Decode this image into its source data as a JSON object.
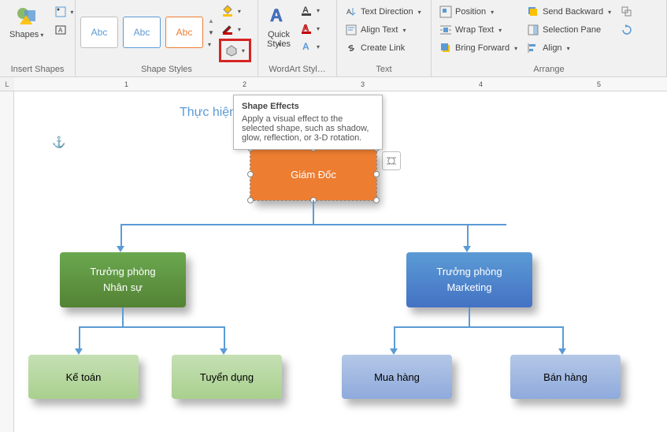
{
  "ribbon": {
    "groups": {
      "insert_shapes": {
        "label": "Insert Shapes",
        "shapes_btn": "Shapes"
      },
      "shape_styles": {
        "label": "Shape Styles",
        "thumb_text": "Abc",
        "shape_fill": "Shape Fill",
        "shape_outline": "Shape Outline",
        "shape_effects": "Shape Effects"
      },
      "wordart": {
        "label": "WordArt Styl…",
        "quick_styles": "Quick\nStyles"
      },
      "text": {
        "label": "Text",
        "text_direction": "Text Direction",
        "align_text": "Align Text",
        "create_link": "Create Link"
      },
      "arrange": {
        "label": "Arrange",
        "position": "Position",
        "wrap_text": "Wrap Text",
        "bring_forward": "Bring Forward",
        "send_backward": "Send Backward",
        "selection_pane": "Selection Pane",
        "align": "Align"
      }
    }
  },
  "tooltip": {
    "title": "Shape Effects",
    "body": "Apply a visual effect to the selected shape, such as shadow, glow, reflection, or 3-D rotation."
  },
  "document": {
    "title_fragment": "Thực hiện",
    "anchor_symbol": "⚓"
  },
  "chart_data": {
    "type": "org-chart",
    "root": {
      "label": "Giám Đốc",
      "color": "#ed7d31",
      "selected": true,
      "children": [
        {
          "label": "Trưởng phòng\nNhân sự",
          "color": "#548235",
          "children": [
            {
              "label": "Kế toán",
              "color": "#a9d08e"
            },
            {
              "label": "Tuyển dụng",
              "color": "#a9d08e"
            }
          ]
        },
        {
          "label": "Trưởng phòng\nMarketing",
          "color": "#4472c4",
          "children": [
            {
              "label": "Mua hàng",
              "color": "#8faadc"
            },
            {
              "label": "Bán hàng",
              "color": "#8faadc"
            }
          ]
        }
      ]
    }
  },
  "ruler": {
    "ticks": [
      "1",
      "2",
      "3",
      "4",
      "5"
    ]
  }
}
